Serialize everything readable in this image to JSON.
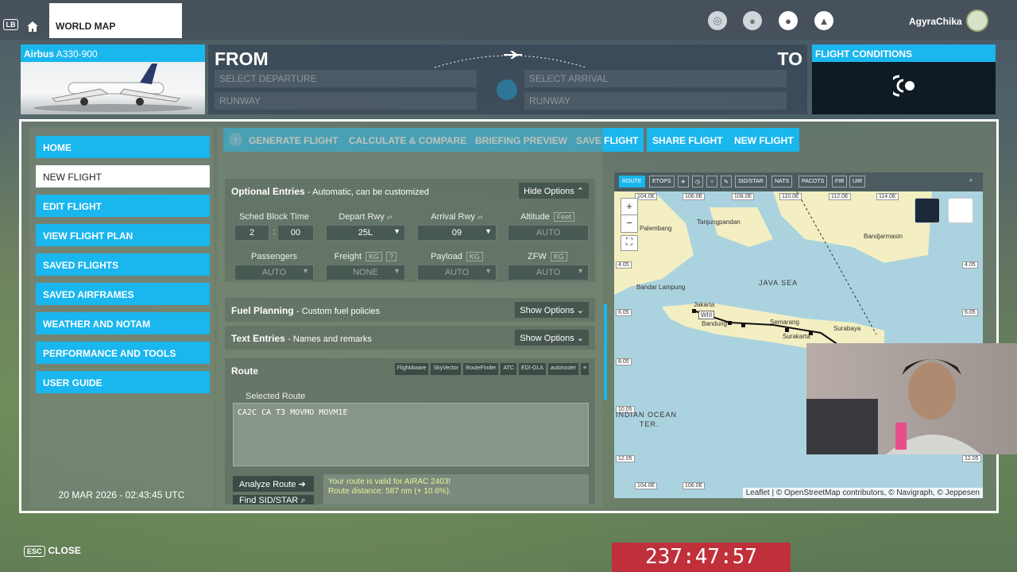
{
  "topbar": {
    "lb_label": "LB",
    "world_map": "WORLD MAP",
    "username": "AgyraChika"
  },
  "aircraft": {
    "make": "Airbus",
    "model": "A330-900"
  },
  "route_header": {
    "from": "FROM",
    "to": "TO",
    "select_departure": "SELECT DEPARTURE",
    "select_arrival": "SELECT ARRIVAL",
    "runway_left": "RUNWAY",
    "runway_right": "RUNWAY"
  },
  "flight_conditions": {
    "title": "FLIGHT CONDITIONS"
  },
  "sidebar": {
    "items": [
      {
        "label": "HOME"
      },
      {
        "label": "NEW FLIGHT"
      },
      {
        "label": "EDIT FLIGHT"
      },
      {
        "label": "VIEW FLIGHT PLAN"
      },
      {
        "label": "SAVED FLIGHTS"
      },
      {
        "label": "SAVED AIRFRAMES"
      },
      {
        "label": "WEATHER AND NOTAM"
      },
      {
        "label": "PERFORMANCE AND TOOLS"
      },
      {
        "label": "USER GUIDE"
      }
    ],
    "datetime": "20 MAR 2026 - 02:43:45 UTC"
  },
  "toolbar": {
    "generate": "GENERATE FLIGHT",
    "calculate": "CALCULATE & COMPARE",
    "briefing": "BRIEFING PREVIEW",
    "save": "SAVE FLIGHT",
    "share": "SHARE FLIGHT",
    "new": "NEW FLIGHT"
  },
  "optional": {
    "title": "Optional Entries",
    "subtitle": "- Automatic, can be customized",
    "toggle": "Hide Options",
    "sched_label": "Sched Block Time",
    "sched_h": "2",
    "sched_sep": ":",
    "sched_m": "00",
    "depart_label": "Depart Rwy",
    "depart_value": "25L",
    "arrival_label": "Arrival Rwy",
    "arrival_value": "09",
    "altitude_label": "Altitude",
    "altitude_unit": "Feet",
    "altitude_value": "AUTO",
    "passengers_label": "Passengers",
    "passengers_value": "AUTO",
    "freight_label": "Freight",
    "freight_unit": "KG",
    "freight_help": "?",
    "freight_value": "NONE",
    "payload_label": "Payload",
    "payload_unit": "KG",
    "payload_value": "AUTO",
    "zfw_label": "ZFW",
    "zfw_unit": "KG",
    "zfw_value": "AUTO"
  },
  "fuel": {
    "title": "Fuel Planning",
    "subtitle": "- Custom fuel policies",
    "toggle": "Show Options"
  },
  "text_entries": {
    "title": "Text Entries",
    "subtitle": "- Names and remarks",
    "toggle": "Show Options"
  },
  "route": {
    "title": "Route",
    "selected_label": "Selected Route",
    "selected_value": "CA2C CA T3 MOVMO MOVM1E",
    "analyze": "Analyze Route",
    "find": "Find SID/STAR",
    "valid_line1": "Your route is valid for AIRAC 2403!",
    "valid_line2": "Route distance: 587 nm (+ 10.6%).",
    "logos": [
      "FlightAware",
      "SkyVector",
      "RouteFinder",
      "ATC",
      "EDI-GLA",
      "autorouter",
      "≡"
    ]
  },
  "map": {
    "tools": [
      "ROUTE",
      "ETOPS",
      "SID/STAR",
      "NATS",
      "PACOTS",
      "FIR",
      "UIR"
    ],
    "lon_top": [
      "104.0E",
      "106.0E",
      "108.0E",
      "110.0E",
      "112.0E",
      "114.0E"
    ],
    "lon_bottom": [
      "104.0E",
      "106.0E"
    ],
    "lat_left": [
      "4.05",
      "6.05",
      "8.05",
      "10.05",
      "12.05"
    ],
    "lat_right": [
      "4.05",
      "6.05",
      "12.05"
    ],
    "places": {
      "palembang": "Palembang",
      "tanjung": "Tanjungpandan",
      "banjarmasin": "Bandjarmasin",
      "java_sea": "JAVA SEA",
      "lampung": "Bandar Lampung",
      "jakarta": "Jakarta",
      "wiii": "WIII",
      "bandung": "Bandung",
      "semarang": "Semarang",
      "surakarta": "Surakarta",
      "surabaya": "Surabaya",
      "indian1": "INDIAN OCEAN",
      "indian2": "TER."
    },
    "zoom_in": "+",
    "zoom_out": "−",
    "attribution": "Leaflet | © OpenStreetMap contributors, © Navigraph, © Jeppesen"
  },
  "footer": {
    "esc": "ESC",
    "close": "CLOSE",
    "timer": "237:47:57"
  },
  "colors": {
    "accent": "#1ab6ee",
    "timer_bg": "#c0303a"
  }
}
